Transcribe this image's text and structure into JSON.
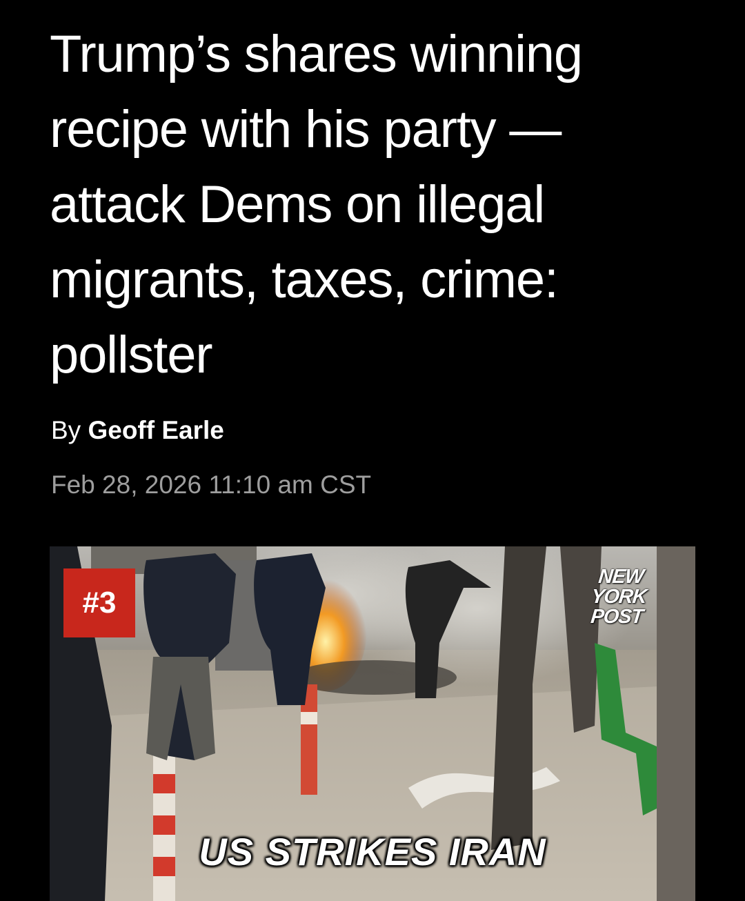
{
  "article": {
    "headline": "Trump’s shares winning recipe with his party — attack Dems on illegal migrants, taxes, crime: pollster",
    "byline_prefix": "By ",
    "author": "Geoff Earle",
    "date": "Feb 28, 2026 11:10 am CST"
  },
  "video": {
    "rank_badge": "#3",
    "logo_lines": [
      "NEW",
      "YORK",
      "POST"
    ],
    "caption": "US STRIKES IRAN"
  },
  "colors": {
    "background": "#000000",
    "headline": "#ffffff",
    "date": "#9e9e9e",
    "badge": "#c8271c"
  }
}
